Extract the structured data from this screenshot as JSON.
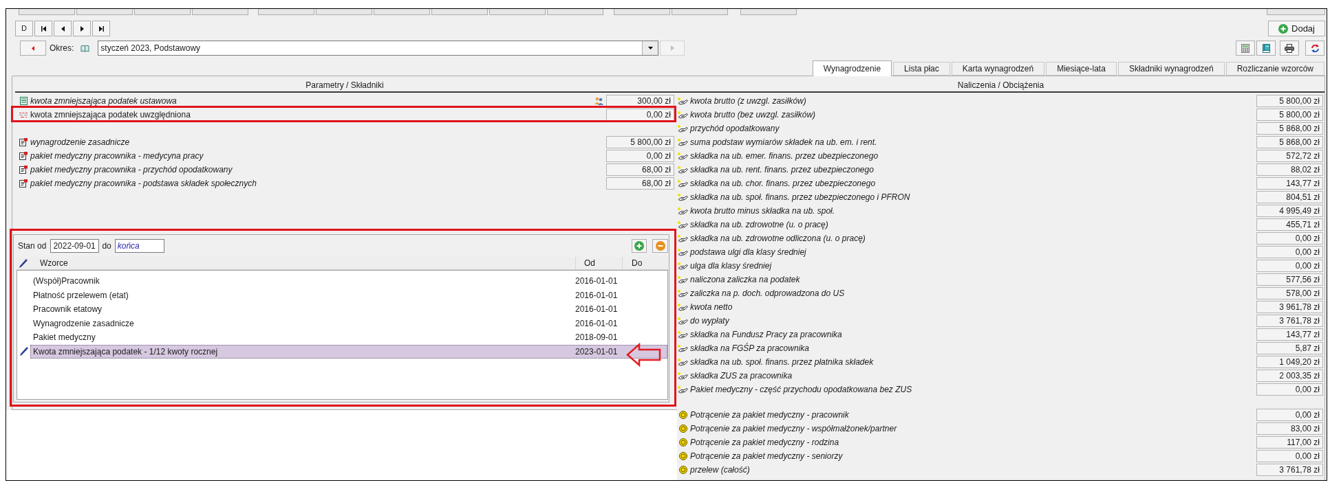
{
  "toolbar": {
    "navigation": [
      {
        "kind": "text",
        "label": "D"
      },
      {
        "kind": "first"
      },
      {
        "kind": "previous"
      },
      {
        "kind": "next"
      },
      {
        "kind": "last"
      }
    ],
    "add_button": {
      "label": "Dodaj"
    },
    "tools": [
      {
        "kind": "calculator"
      },
      {
        "kind": "book"
      },
      {
        "kind": "printer"
      },
      {
        "kind": "refresh"
      }
    ]
  },
  "period": {
    "label": "Okres:",
    "value": "styczeń 2023, Podstawowy",
    "next_disabled": true
  },
  "tabs": [
    {
      "label": "Wynagrodzenie",
      "selected": true
    },
    {
      "label": "Lista płac",
      "selected": false
    },
    {
      "label": "Karta wynagrodzeń",
      "selected": false
    },
    {
      "label": "Miesiące-lata",
      "selected": false
    },
    {
      "label": "Składniki wynagrodzeń",
      "selected": false
    },
    {
      "label": "Rozliczanie wzorców",
      "selected": false
    }
  ],
  "parameters": {
    "title": "Parametry / Składniki",
    "groups": [
      {
        "rows": [
          {
            "kind": "spreadsheet",
            "label": "kwota zmniejszająca podatek ustawowa",
            "value": "300,00 zł",
            "italic": true,
            "people_icon": true,
            "highlighted": false
          },
          {
            "kind": "dashes",
            "label": "kwota zmniejszająca podatek uwzględniona",
            "value": "0,00 zł",
            "italic": false,
            "people_icon": false,
            "highlighted": true
          }
        ]
      },
      {
        "rows": [
          {
            "kind": "document",
            "label": "wynagrodzenie zasadnicze",
            "value": "5 800,00 zł",
            "italic": true,
            "people_icon": false,
            "highlighted": false
          },
          {
            "kind": "document",
            "label": "pakiet medyczny pracownika - medycyna pracy",
            "value": "0,00 zł",
            "italic": true,
            "people_icon": false,
            "highlighted": false
          },
          {
            "kind": "document",
            "label": "pakiet medyczny pracownika - przychód opodatkowany",
            "value": "68,00 zł",
            "italic": true,
            "people_icon": false,
            "highlighted": false
          },
          {
            "kind": "document",
            "label": "pakiet medyczny pracownika - podstawa składek społecznych",
            "value": "68,00 zł",
            "italic": true,
            "people_icon": false,
            "highlighted": false
          }
        ]
      }
    ]
  },
  "templates": {
    "highlighted": true,
    "from_label": "Stan od",
    "from_value": "2022-09-01",
    "to_label": "do",
    "to_value": "końca",
    "columns": [
      "Wzorce",
      "Od",
      "Do"
    ],
    "rows": [
      {
        "name": "(Współ)Pracownik",
        "from": "2016-01-01",
        "selected": false,
        "arrow": false
      },
      {
        "name": "Płatność przelewem (etat)",
        "from": "2016-01-01",
        "selected": false,
        "arrow": false
      },
      {
        "name": "Pracownik etatowy",
        "from": "2016-01-01",
        "selected": false,
        "arrow": false
      },
      {
        "name": "Wynagrodzenie zasadnicze",
        "from": "2016-01-01",
        "selected": false,
        "arrow": false
      },
      {
        "name": "Pakiet medyczny",
        "from": "2018-09-01",
        "selected": false,
        "arrow": false
      },
      {
        "name": "Kwota zmniejszająca podatek - 1/12 kwoty rocznej",
        "from": "2023-01-01",
        "selected": true,
        "arrow": true
      }
    ]
  },
  "charges": {
    "title": "Naliczenia / Obciążenia",
    "groups": [
      {
        "rows": [
          {
            "kind": "hand",
            "label": "kwota brutto (z uwzgl. zasiłków)",
            "value": "5 800,00 zł"
          },
          {
            "kind": "hand",
            "label": "kwota brutto (bez uwzgl. zasiłków)",
            "value": "5 800,00 zł"
          },
          {
            "kind": "hand",
            "label": "przychód opodatkowany",
            "value": "5 868,00 zł"
          },
          {
            "kind": "hand",
            "label": "suma podstaw wymiarów składek na ub. em. i rent.",
            "value": "5 868,00 zł"
          },
          {
            "kind": "hand",
            "label": "składka na ub. emer. finans. przez ubezpieczonego",
            "value": "572,72 zł"
          },
          {
            "kind": "hand",
            "label": "składka na ub. rent. finans. przez ubezpieczonego",
            "value": "88,02 zł"
          },
          {
            "kind": "hand",
            "label": "składka na ub. chor. finans. przez ubezpieczonego",
            "value": "143,77 zł"
          },
          {
            "kind": "hand",
            "label": "składka na ub. społ. finans. przez ubezpieczonego i PFRON",
            "value": "804,51 zł"
          },
          {
            "kind": "hand",
            "label": "kwota brutto minus składka na ub. społ.",
            "value": "4 995,49 zł"
          },
          {
            "kind": "hand",
            "label": "składka na ub. zdrowotne (u. o pracę)",
            "value": "455,71 zł"
          },
          {
            "kind": "hand",
            "label": "składka na ub. zdrowotne odliczona (u. o pracę)",
            "value": "0,00 zł"
          },
          {
            "kind": "hand",
            "label": "podstawa ulgi dla klasy średniej",
            "value": "0,00 zł"
          },
          {
            "kind": "hand",
            "label": "ulga dla klasy średniej",
            "value": "0,00 zł"
          },
          {
            "kind": "hand",
            "label": "naliczona zaliczka na podatek",
            "value": "577,56 zł"
          },
          {
            "kind": "hand",
            "label": "zaliczka na p. doch. odprowadzona do US",
            "value": "578,00 zł"
          },
          {
            "kind": "hand",
            "label": "kwota netto",
            "value": "3 961,78 zł"
          },
          {
            "kind": "hand",
            "label": "do wypłaty",
            "value": "3 761,78 zł"
          },
          {
            "kind": "hand",
            "label": "składka na Fundusz Pracy za pracownika",
            "value": "143,77 zł"
          },
          {
            "kind": "hand",
            "label": "składka na FGŚP za pracownika",
            "value": "5,87 zł"
          },
          {
            "kind": "hand",
            "label": "składka na ub. społ. finans. przez płatnika składek",
            "value": "1 049,20 zł"
          },
          {
            "kind": "hand",
            "label": "składka ZUS za pracownika",
            "value": "2 003,35 zł"
          },
          {
            "kind": "hand",
            "label": "Pakiet medyczny - część przychodu opodatkowana bez ZUS",
            "value": "0,00 zł"
          }
        ]
      },
      {
        "rows": [
          {
            "kind": "coin",
            "label": "Potrącenie za pakiet medyczny - pracownik",
            "value": "0,00 zł"
          },
          {
            "kind": "coin",
            "label": "Potrącenie za pakiet medyczny - współmałżonek/partner",
            "value": "83,00 zł"
          },
          {
            "kind": "coin",
            "label": "Potrącenie za pakiet medyczny - rodzina",
            "value": "117,00 zł"
          },
          {
            "kind": "coin",
            "label": "Potrącenie za pakiet medyczny - seniorzy",
            "value": "0,00 zł"
          },
          {
            "kind": "coin",
            "label": "przelew (całość)",
            "value": "3 761,78 zł"
          }
        ]
      }
    ]
  }
}
